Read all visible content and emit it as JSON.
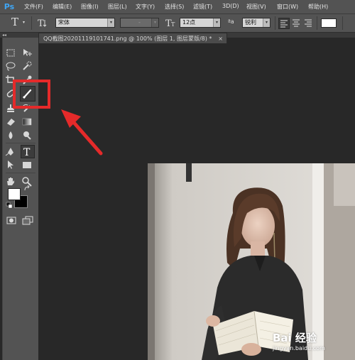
{
  "app": {
    "logo_text": "Ps"
  },
  "menubar": {
    "items": [
      "文件(F)",
      "编辑(E)",
      "图像(I)",
      "图层(L)",
      "文字(Y)",
      "选择(S)",
      "滤镜(T)",
      "3D(D)",
      "视图(V)",
      "窗口(W)",
      "帮助(H)"
    ]
  },
  "options_bar": {
    "tool_glyph": "T",
    "font_family": "宋体",
    "font_style": "-",
    "font_size": "12点",
    "aa_label": "ªa",
    "antialias": "锐利",
    "text_color": "#ffffff"
  },
  "document": {
    "tab_title": "QQ截图20201119101741.png @ 100% (图层 1, 图层蒙版/8) *",
    "close_glyph": "×"
  },
  "toolbar": {
    "collapse_glyph": "◂◂"
  },
  "annotation": {
    "highlight_color": "#e52a2a",
    "arrow_color": "#e52a2a"
  },
  "watermark": {
    "logo": "Bai 经验",
    "url": "jingyan.baidu.com"
  }
}
